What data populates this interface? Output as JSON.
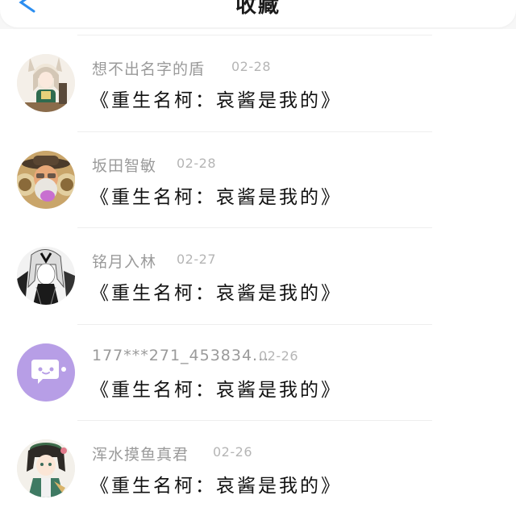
{
  "header": {
    "title": "收藏"
  },
  "items": [
    {
      "username": "想不出名字的盾",
      "date": "02-28",
      "title": "《重生名柯：哀酱是我的》",
      "avatar_icon": "anime-girl-avatar"
    },
    {
      "username": "坂田智敏",
      "date": "02-28",
      "title": "《重生名柯：哀酱是我的》",
      "avatar_icon": "man-with-hat-avatar"
    },
    {
      "username": "铭月入林",
      "date": "02-27",
      "title": "《重生名柯：哀酱是我的》",
      "avatar_icon": "monochrome-anime-avatar"
    },
    {
      "username": "177***271_453834...",
      "date": "02-26",
      "title": "《重生名柯：哀酱是我的》",
      "avatar_icon": "default-chat-bubble-avatar"
    },
    {
      "username": "浑水摸鱼真君",
      "date": "02-26",
      "title": "《重生名柯：哀酱是我的》",
      "avatar_icon": "anime-boy-avatar"
    }
  ],
  "colors": {
    "default_avatar_bg": "#b79ee6",
    "back_arrow": "#2c8ef0"
  }
}
